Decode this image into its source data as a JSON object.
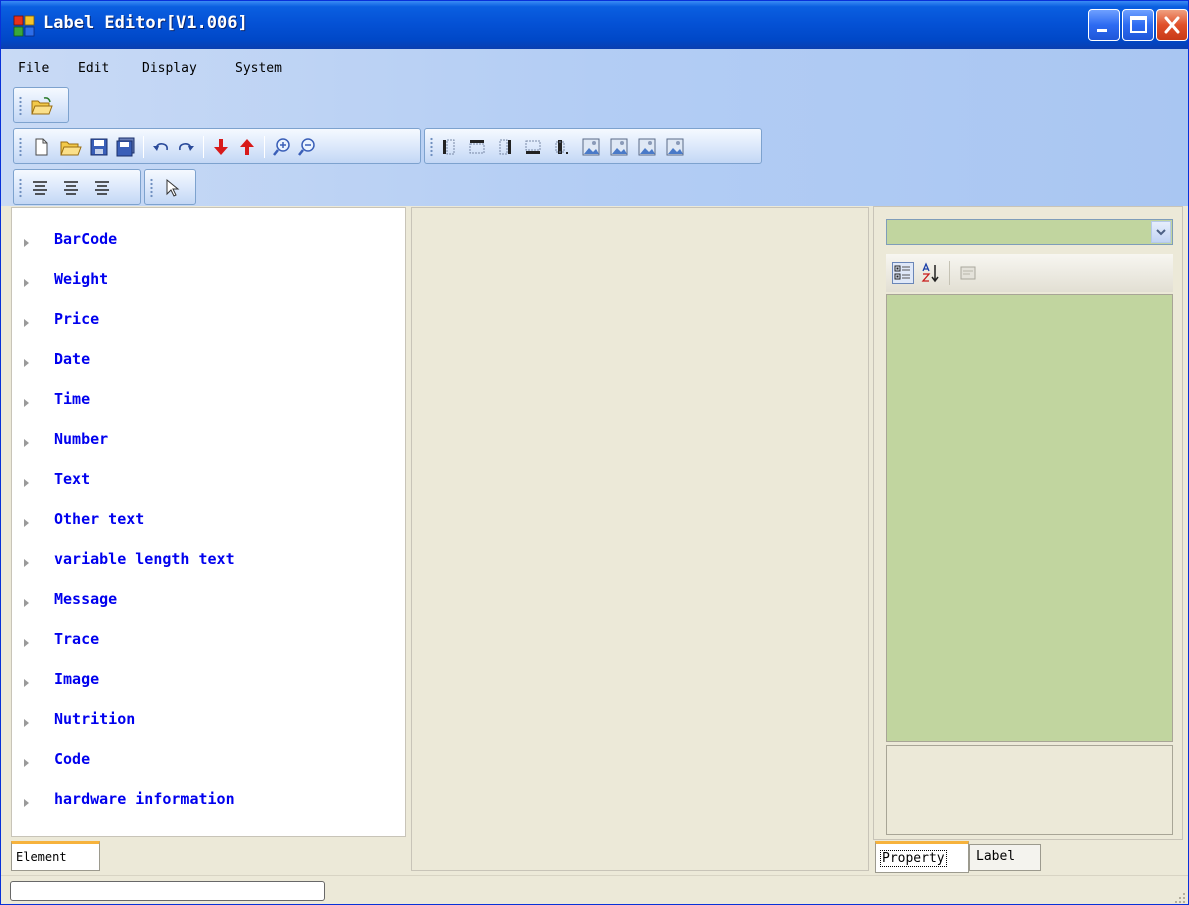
{
  "window": {
    "title": "Label Editor[V1.006]",
    "icons": {
      "app": "app-icon",
      "minimize": "minimize-icon",
      "maximize": "maximize-icon",
      "close": "close-icon"
    }
  },
  "menu": [
    "File",
    "Edit",
    "Display",
    "System"
  ],
  "toolbar": {
    "open_strip": [
      "open-icon"
    ],
    "main_strip": [
      "new-icon",
      "open-icon",
      "save-icon",
      "save-as-icon",
      "undo-icon",
      "redo-icon",
      "move-down-icon",
      "move-up-icon",
      "zoom-in-icon",
      "zoom-out-icon"
    ],
    "layout_strip": [
      "align-left-edge-icon",
      "align-top-edge-icon",
      "align-right-edge-icon",
      "align-bottom-edge-icon",
      "align-center-icon",
      "image-icon",
      "image-icon",
      "image-icon",
      "image-icon"
    ],
    "align_strip": [
      "align-left-text-icon",
      "align-center-text-icon",
      "align-right-text-icon"
    ],
    "pointer_strip": [
      "pointer-icon"
    ]
  },
  "elements": {
    "items": [
      "BarCode",
      "Weight",
      "Price",
      "Date",
      "Time",
      "Number",
      "Text",
      "Other text",
      "variable length text",
      "Message",
      "Trace",
      "Image",
      "Nutrition",
      "Code",
      "hardware information"
    ],
    "tab": "Element"
  },
  "properties": {
    "selected_object": "",
    "toolbar_icons": [
      "categorized-icon",
      "alphabetical-sort-icon",
      "property-pages-icon"
    ],
    "tabs": [
      "Property",
      "Label"
    ]
  },
  "colors": {
    "title_blue": "#0552d6",
    "link_blue": "#0000ee",
    "property_green": "#c1d59f",
    "tab_accent": "#f6b23c"
  }
}
